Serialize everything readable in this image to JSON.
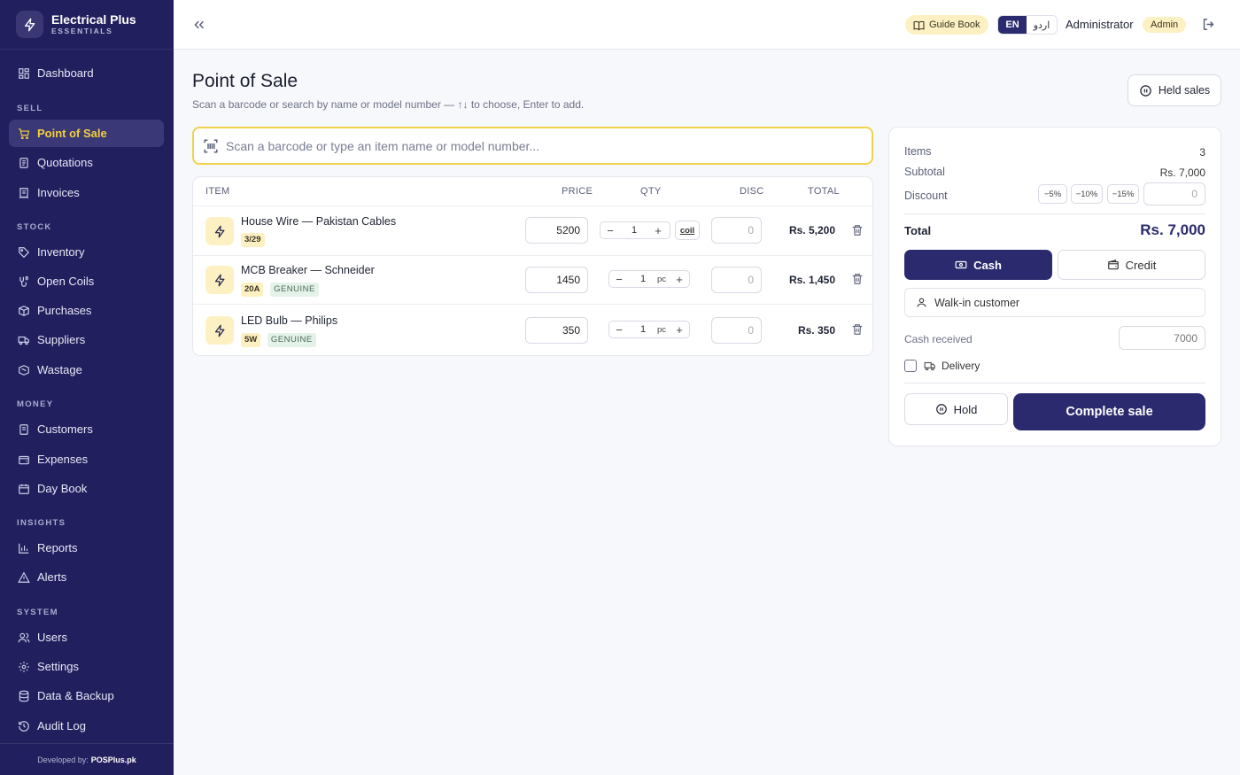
{
  "brand": {
    "name": "Electrical Plus",
    "sub": "ESSENTIALS"
  },
  "sidebar": {
    "dashboard": "Dashboard",
    "sections": {
      "sell": "SELL",
      "stock": "STOCK",
      "money": "MONEY",
      "insights": "INSIGHTS",
      "system": "SYSTEM"
    },
    "items": {
      "pos": "Point of Sale",
      "quotations": "Quotations",
      "invoices": "Invoices",
      "inventory": "Inventory",
      "open_coils": "Open Coils",
      "purchases": "Purchases",
      "suppliers": "Suppliers",
      "wastage": "Wastage",
      "customers": "Customers",
      "expenses": "Expenses",
      "day_book": "Day Book",
      "reports": "Reports",
      "alerts": "Alerts",
      "users": "Users",
      "settings": "Settings",
      "data_backup": "Data & Backup",
      "audit_log": "Audit Log"
    },
    "footer_prefix": "Developed by:",
    "footer_brand": "POSPlus.pk"
  },
  "topbar": {
    "guide_book": "Guide Book",
    "lang_en": "EN",
    "lang_ur": "اردو",
    "user_name": "Administrator",
    "role": "Admin"
  },
  "page": {
    "title": "Point of Sale",
    "subtitle": "Scan a barcode or search by name or model number — ↑↓ to choose, Enter to add.",
    "held_sales": "Held sales"
  },
  "search": {
    "placeholder": "Scan a barcode or type an item name or model number..."
  },
  "cart": {
    "headers": {
      "item": "ITEM",
      "price": "PRICE",
      "qty": "QTY",
      "disc": "DISC",
      "total": "TOTAL"
    },
    "rows": [
      {
        "name": "House Wire — Pakistan Cables",
        "tag1": "3/29",
        "price": "5200",
        "qty": "1",
        "unit": "coil",
        "disc": "0",
        "total": "Rs. 5,200"
      },
      {
        "name": "MCB Breaker — Schneider",
        "tag1": "20A",
        "tag2": "GENUINE",
        "price": "1450",
        "qty": "1",
        "unit": "pc",
        "disc": "0",
        "total": "Rs. 1,450"
      },
      {
        "name": "LED Bulb — Philips",
        "tag1": "5W",
        "tag2": "GENUINE",
        "price": "350",
        "qty": "1",
        "unit": "pc",
        "disc": "0",
        "total": "Rs. 350"
      }
    ]
  },
  "summary": {
    "items_label": "Items",
    "items_value": "3",
    "subtotal_label": "Subtotal",
    "subtotal_value": "Rs. 7,000",
    "discount_label": "Discount",
    "disc_chips": [
      "−5%",
      "−10%",
      "−15%"
    ],
    "discount_value": "0",
    "total_label": "Total",
    "total_value": "Rs. 7,000",
    "cash": "Cash",
    "credit": "Credit",
    "customer": "Walk-in customer",
    "cash_received_label": "Cash received",
    "cash_received_placeholder": "7000",
    "delivery": "Delivery",
    "hold": "Hold",
    "complete": "Complete sale"
  },
  "colors": {
    "sidebar": "#221f5e",
    "accent": "#2b2a6e",
    "highlight": "#f5cf3c",
    "tag_yellow": "#fdf1c3"
  }
}
